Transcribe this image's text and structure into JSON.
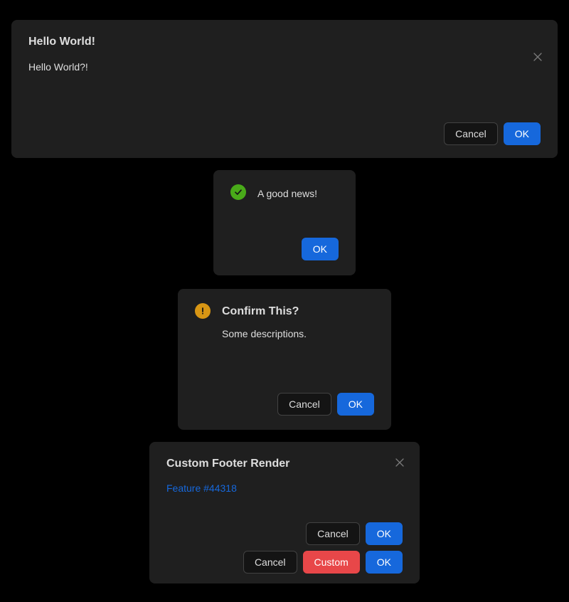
{
  "page": {
    "background_color": "#000000",
    "surface_color": "#1f1f1f"
  },
  "colors": {
    "primary": "#1668dc",
    "danger": "#e84749",
    "success": "#49aa19",
    "warning": "#d89614",
    "link": "#1668dc",
    "default_border": "#424242",
    "default_bg": "#141414",
    "text": "#ffffffd9"
  },
  "dialogs": {
    "hello": {
      "title": "Hello World!",
      "body": "Hello World?!",
      "close_icon": "close-icon",
      "buttons": {
        "cancel": "Cancel",
        "ok": "OK"
      }
    },
    "success": {
      "icon": "check-circle-icon",
      "message": "A good news!",
      "buttons": {
        "ok": "OK"
      }
    },
    "confirm": {
      "icon": "exclamation-circle-icon",
      "title": "Confirm This?",
      "description": "Some descriptions.",
      "buttons": {
        "cancel": "Cancel",
        "ok": "OK"
      }
    },
    "custom": {
      "title": "Custom Footer Render",
      "close_icon": "close-icon",
      "link": "Feature #44318",
      "footer_rows": [
        {
          "cancel": "Cancel",
          "ok": "OK"
        },
        {
          "cancel": "Cancel",
          "custom": "Custom",
          "ok": "OK"
        }
      ]
    }
  }
}
